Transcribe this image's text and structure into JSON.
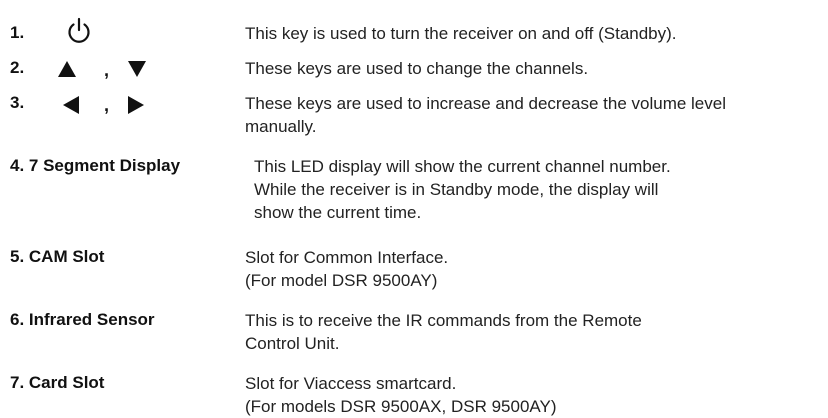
{
  "items": [
    {
      "number": "1.",
      "icon": "power-icon",
      "desc": [
        "This key is used to turn the receiver on and off (Standby)."
      ]
    },
    {
      "number": "2.",
      "icons": [
        "up-triangle-icon",
        "down-triangle-icon"
      ],
      "separator": ",",
      "desc": [
        "These keys are used to change the channels."
      ]
    },
    {
      "number": "3.",
      "icons": [
        "left-triangle-icon",
        "right-triangle-icon"
      ],
      "separator": ",",
      "desc": [
        "These keys are used to increase and decrease the volume level",
        "manually."
      ]
    },
    {
      "label": "4. 7 Segment Display",
      "desc": [
        "This LED display will show the current channel number.",
        "While the receiver is in Standby mode, the display will",
        "show the current time."
      ]
    },
    {
      "label": "5. CAM Slot",
      "desc": [
        "Slot for Common Interface.",
        "(For model DSR 9500AY)"
      ]
    },
    {
      "label": "6. Infrared Sensor",
      "desc": [
        "This is to receive the IR commands from the Remote",
        "Control Unit."
      ]
    },
    {
      "label": "7. Card Slot",
      "desc": [
        "Slot for Viaccess smartcard.",
        "(For models DSR 9500AX, DSR 9500AY)"
      ]
    }
  ]
}
